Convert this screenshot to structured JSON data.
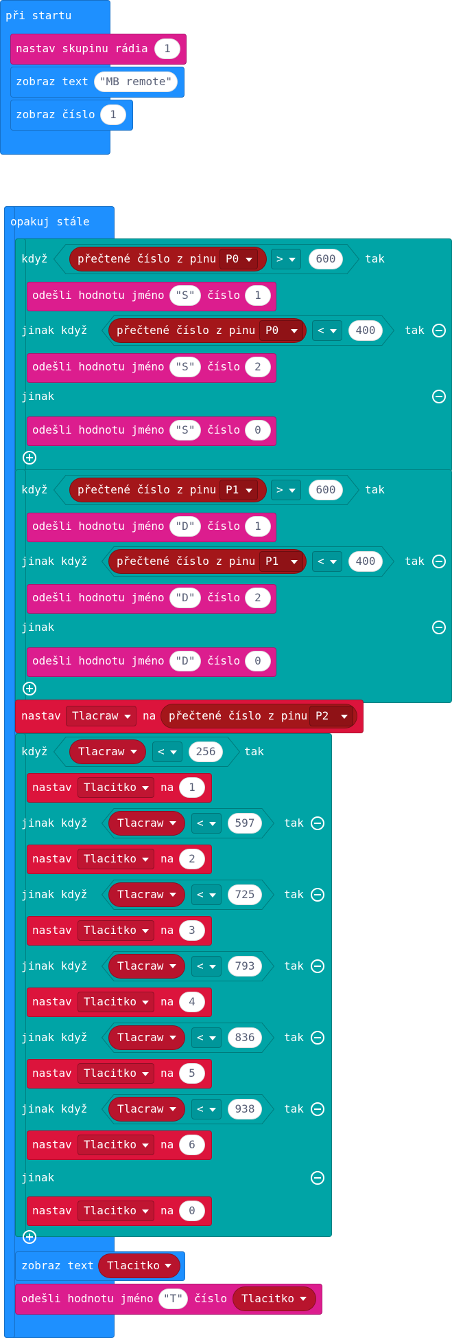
{
  "start_block": {
    "header": "při startu",
    "set_radio_group": {
      "label": "nastav skupinu rádia",
      "value": "1"
    },
    "show_text": {
      "label": "zobraz text",
      "value": "\"MB remote\""
    },
    "show_number": {
      "label": "zobraz číslo",
      "value": "1"
    }
  },
  "forever_block": {
    "header": "opakuj stále"
  },
  "kw": {
    "if": "když",
    "then": "tak",
    "else_if": "jinak když",
    "else": "jinak",
    "read_pin": "přečtené číslo z pinu",
    "send_value": "odešli hodnotu jméno",
    "number": "číslo",
    "set": "nastav",
    "to": "na",
    "show_text": "zobraz text"
  },
  "if_p0": {
    "pin": "P0",
    "cond1": {
      "op": ">",
      "value": "600"
    },
    "cond2": {
      "op": "<",
      "value": "400"
    },
    "send_name": "\"S\"",
    "send_values": [
      "1",
      "2",
      "0"
    ]
  },
  "if_p1": {
    "pin": "P1",
    "cond1": {
      "op": ">",
      "value": "600"
    },
    "cond2": {
      "op": "<",
      "value": "400"
    },
    "send_name": "\"D\"",
    "send_values": [
      "1",
      "2",
      "0"
    ]
  },
  "set_tlacraw": {
    "variable": "Tlacraw",
    "pin": "P2"
  },
  "button_chain": {
    "variable": "Tlacraw",
    "target": "Tlacitko",
    "op": "<",
    "thresholds": [
      "256",
      "597",
      "725",
      "793",
      "836",
      "938"
    ],
    "results": [
      "1",
      "2",
      "3",
      "4",
      "5",
      "6"
    ],
    "else_result": "0"
  },
  "final_show": {
    "variable": "Tlacitko"
  },
  "final_send": {
    "name": "\"T\"",
    "variable": "Tlacitko"
  },
  "colors": {
    "loops": "#1e90ff",
    "logic": "#00a4a6",
    "radio": "#dc1d8e",
    "variables": "#dc143c",
    "pins": "#a4161a"
  }
}
